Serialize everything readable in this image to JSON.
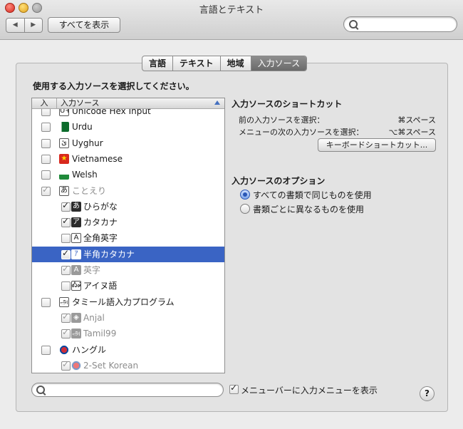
{
  "window": {
    "title": "言語とテキスト"
  },
  "toolbar": {
    "back_glyph": "◀",
    "forward_glyph": "▶",
    "show_all_label": "すべてを表示",
    "search_placeholder": ""
  },
  "tabs": [
    {
      "label": "言語",
      "active": false
    },
    {
      "label": "テキスト",
      "active": false
    },
    {
      "label": "地域",
      "active": false
    },
    {
      "label": "入力ソース",
      "active": true
    }
  ],
  "instruction": "使用する入力ソースを選択してください。",
  "list": {
    "header_check": "入",
    "header_name": "入力ソース",
    "rows": [
      {
        "label": "Unicode Hex Input",
        "checked": false,
        "icon": "unicode-hex-icon",
        "glyph": "U+",
        "indent": 0,
        "dim": false
      },
      {
        "label": "Urdu",
        "checked": false,
        "icon": "pakistan-flag-icon",
        "glyph": "",
        "indent": 0,
        "dim": false
      },
      {
        "label": "Uyghur",
        "checked": false,
        "icon": "uyghur-script-icon",
        "glyph": "ئ",
        "indent": 0,
        "dim": false
      },
      {
        "label": "Vietnamese",
        "checked": false,
        "icon": "vietnam-flag-icon",
        "glyph": "★",
        "indent": 0,
        "dim": false
      },
      {
        "label": "Welsh",
        "checked": false,
        "icon": "wales-flag-icon",
        "glyph": "",
        "indent": 0,
        "dim": false
      },
      {
        "label": "ことえり",
        "checked": true,
        "icon": "kotoeri-hiragana-icon",
        "glyph": "あ",
        "indent": 0,
        "dim": true
      },
      {
        "label": "ひらがな",
        "checked": true,
        "icon": "hiragana-icon",
        "glyph": "あ",
        "indent": 1,
        "dim": false
      },
      {
        "label": "カタカナ",
        "checked": true,
        "icon": "katakana-icon",
        "glyph": "ア",
        "indent": 1,
        "dim": false
      },
      {
        "label": "全角英字",
        "checked": false,
        "icon": "fullwidth-alpha-icon",
        "glyph": "A",
        "indent": 1,
        "dim": false
      },
      {
        "label": "半角カタカナ",
        "checked": true,
        "icon": "halfwidth-katakana-icon",
        "glyph": "ｱ",
        "indent": 1,
        "dim": false,
        "selected": true
      },
      {
        "label": "英字",
        "checked": true,
        "icon": "alpha-icon",
        "glyph": "A",
        "indent": 1,
        "dim": true
      },
      {
        "label": "アイヌ語",
        "checked": false,
        "icon": "ainu-icon",
        "glyph": "ᎣᏍ",
        "indent": 1,
        "dim": false
      },
      {
        "label": "タミール語入力プログラム",
        "checked": false,
        "icon": "tamil-icon",
        "glyph": "அ",
        "indent": 0,
        "dim": false
      },
      {
        "label": "Anjal",
        "checked": true,
        "icon": "anjal-icon",
        "glyph": "◈",
        "indent": 1,
        "dim": true
      },
      {
        "label": "Tamil99",
        "checked": true,
        "icon": "tamil99-icon",
        "glyph": "அ",
        "indent": 1,
        "dim": true
      },
      {
        "label": "ハングル",
        "checked": false,
        "icon": "korea-flag-icon",
        "glyph": "",
        "indent": 0,
        "dim": false
      },
      {
        "label": "2-Set Korean",
        "checked": true,
        "icon": "korean-2set-icon",
        "glyph": "",
        "indent": 1,
        "dim": true
      }
    ]
  },
  "shortcuts": {
    "title": "入力ソースのショートカット",
    "items": [
      {
        "label": "前の入力ソースを選択：",
        "key": "⌘スペース"
      },
      {
        "label": "メニューの次の入力ソースを選択：",
        "key": "⌥⌘スペース"
      }
    ],
    "button_label": "キーボードショートカット..."
  },
  "options": {
    "title": "入力ソースのオプション",
    "choices": [
      {
        "label": "すべての書類で同じものを使用",
        "selected": true
      },
      {
        "label": "書類ごとに異なるものを使用",
        "selected": false
      }
    ]
  },
  "bottom": {
    "search_placeholder": "",
    "show_menu_label": "メニューバーに入力メニューを表示",
    "show_menu_checked": true,
    "help_label": "?"
  }
}
